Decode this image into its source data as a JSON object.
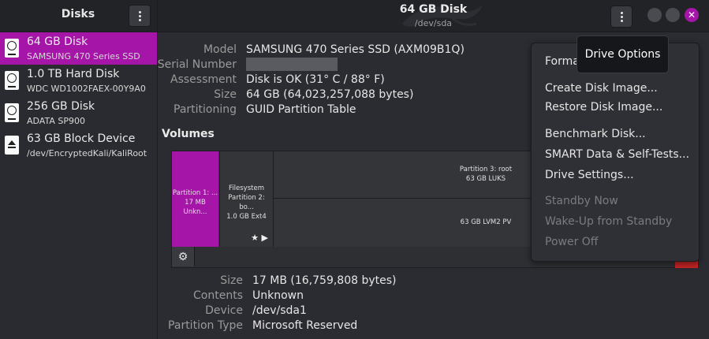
{
  "sidebar": {
    "title": "Disks",
    "disks": [
      {
        "name": "64 GB Disk",
        "sub": "SAMSUNG 470 Series SSD",
        "selected": true
      },
      {
        "name": "1.0 TB Hard Disk",
        "sub": "WDC WD1002FAEX-00Y9A0"
      },
      {
        "name": "256 GB Disk",
        "sub": "ADATA SP900"
      },
      {
        "name": "63 GB Block Device",
        "sub": "/dev/EncryptedKali/KaliRoot"
      }
    ]
  },
  "header": {
    "title": "64 GB Disk",
    "subtitle": "/dev/sda",
    "close_glyph": "✕"
  },
  "details": {
    "model_label": "Model",
    "model": "SAMSUNG 470 Series SSD (AXM09B1Q)",
    "serial_label": "Serial Number",
    "assessment_label": "Assessment",
    "assessment": "Disk is OK (31° C / 88° F)",
    "size_label": "Size",
    "size": "64 GB (64,023,257,088 bytes)",
    "partitioning_label": "Partitioning",
    "partitioning": "GUID Partition Table"
  },
  "volumes": {
    "title": "Volumes",
    "p1": {
      "line1": "Partition 1: ...",
      "line2": "17 MB Unkn..."
    },
    "p2": {
      "line1": "Filesystem",
      "line2": "Partition 2: bo...",
      "line3": "1.0 GB Ext4",
      "glyphs": "★ ▶"
    },
    "p3": {
      "line1": "Partition 3: root",
      "line2": "63 GB LUKS"
    },
    "p3_inner": {
      "line1": "63 GB LVM2 PV"
    },
    "gear_glyph": "⚙"
  },
  "partition_details": {
    "size_label": "Size",
    "size": "17 MB (16,759,808 bytes)",
    "contents_label": "Contents",
    "contents": "Unknown",
    "device_label": "Device",
    "device": "/dev/sda1",
    "type_label": "Partition Type",
    "type": "Microsoft Reserved"
  },
  "menu": {
    "items": [
      {
        "label": "Format Disk...",
        "disabled": false
      },
      {
        "label": "Create Disk Image...",
        "disabled": false
      },
      {
        "label": "Restore Disk Image...",
        "disabled": false
      },
      {
        "label": "Benchmark Disk...",
        "disabled": false
      },
      {
        "label": "SMART Data & Self-Tests...",
        "disabled": false
      },
      {
        "label": "Drive Settings...",
        "disabled": false
      },
      {
        "label": "Standby Now",
        "disabled": true
      },
      {
        "label": "Wake-Up from Standby",
        "disabled": true
      },
      {
        "label": "Power Off",
        "disabled": true
      }
    ]
  },
  "tooltip": "Drive Options",
  "colors": {
    "accent": "#a516a8",
    "danger": "#c02424"
  }
}
